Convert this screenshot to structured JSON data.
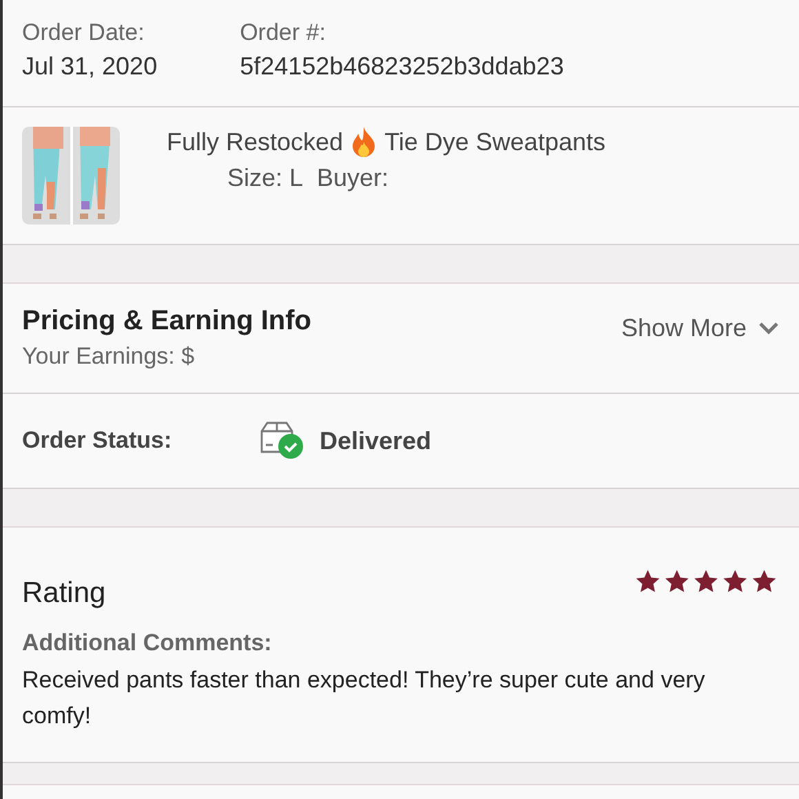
{
  "order_info": {
    "date_label": "Order Date:",
    "date": "Jul 31, 2020",
    "number_label": "Order #:",
    "number": "5f24152b46823252b3ddab23"
  },
  "item": {
    "kind": "picture",
    "title_start": "Fully Restocked",
    "title_end": "Tie Dye Sweatpants",
    "size": "Size: L",
    "buyer_label": "Buyer:"
  },
  "pricing": {
    "title": "Pricing & Earning Info",
    "earnings": "Your Earnings: $",
    "toggle": "Show More",
    "expanded": false
  },
  "status": {
    "label": "Order Status:",
    "value": "Delivered"
  },
  "rating": {
    "title": "Rating",
    "stars": 5,
    "comments_label": "Additional Comments:",
    "comments": "Received pants faster than expected! They’re super cute and very comfy!"
  }
}
